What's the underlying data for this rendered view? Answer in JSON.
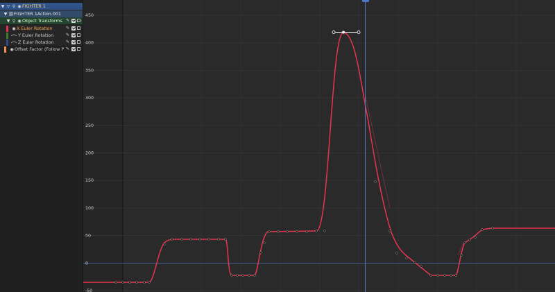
{
  "channels": {
    "rows": [
      {
        "label": "FIGHTER 1",
        "kind": "obj"
      },
      {
        "label": "FIGHTER 1Action.001",
        "kind": "act"
      },
      {
        "label": "Object Transforms",
        "kind": "grp"
      },
      {
        "label": "X Euler Rotation",
        "kind": "ch",
        "color": "#e8304f",
        "selected": true
      },
      {
        "label": "Y Euler Rotation",
        "kind": "ch",
        "color": "#58b432"
      },
      {
        "label": "Z Euler Rotation",
        "kind": "ch",
        "color": "#3b68c8"
      },
      {
        "label": "Offset Factor (Follow Path)",
        "kind": "extra",
        "color": "#ef8a4f"
      }
    ]
  },
  "graph": {
    "value_axis_labels": [
      "450",
      "400",
      "350",
      "300",
      "250",
      "200",
      "150",
      "100",
      "50",
      "0",
      "-50"
    ],
    "curve_color": "#e8354f",
    "playhead_color": "#4f79b8"
  }
}
